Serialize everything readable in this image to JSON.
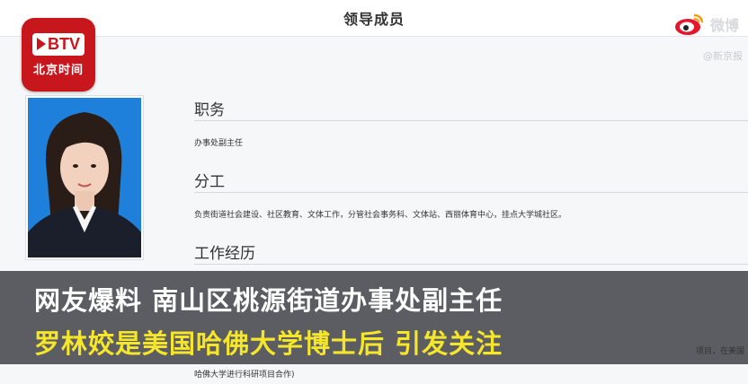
{
  "header": {
    "title": "领导成员"
  },
  "logo": {
    "mark": "BTV",
    "subtitle": "北京时间"
  },
  "weibo": {
    "text": "微博",
    "sub": "@新京报"
  },
  "profile": {
    "sections": [
      {
        "title": "职务",
        "text": "办事处副主任"
      },
      {
        "title": "分工",
        "text": "负责街道社会建设、社区教育、文体工作，分管社会事务科、文体站、西丽体育中心，挂点大学城社区。"
      },
      {
        "title": "工作经历",
        "text": ""
      }
    ],
    "bg_right_text": "项目，在美国",
    "footer_text": "哈佛大学进行科研项目合作)"
  },
  "banner": {
    "line1": "网友爆料 南山区桃源街道办事处副主任",
    "line2": "罗林姣是美国哈佛大学博士后 引发关注"
  }
}
